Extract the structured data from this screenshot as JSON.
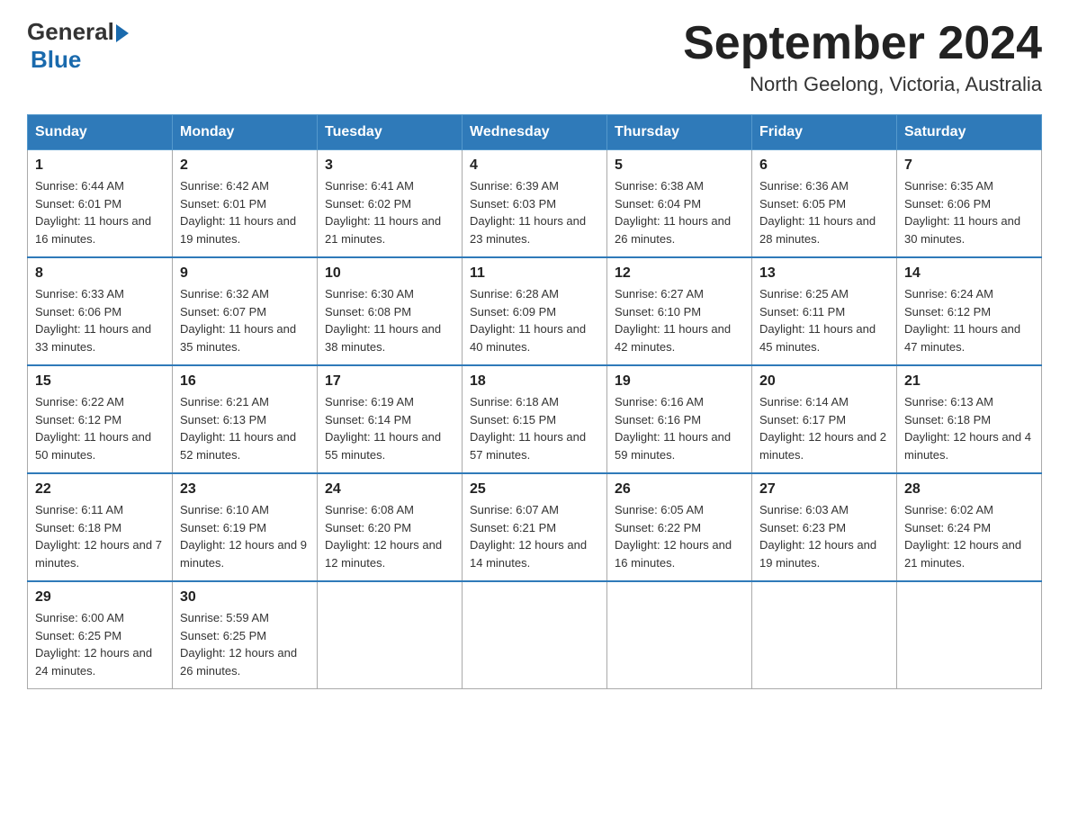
{
  "logo": {
    "text_general": "General",
    "text_blue": "Blue"
  },
  "title": "September 2024",
  "subtitle": "North Geelong, Victoria, Australia",
  "headers": [
    "Sunday",
    "Monday",
    "Tuesday",
    "Wednesday",
    "Thursday",
    "Friday",
    "Saturday"
  ],
  "weeks": [
    [
      {
        "day": "1",
        "sunrise": "6:44 AM",
        "sunset": "6:01 PM",
        "daylight": "11 hours and 16 minutes."
      },
      {
        "day": "2",
        "sunrise": "6:42 AM",
        "sunset": "6:01 PM",
        "daylight": "11 hours and 19 minutes."
      },
      {
        "day": "3",
        "sunrise": "6:41 AM",
        "sunset": "6:02 PM",
        "daylight": "11 hours and 21 minutes."
      },
      {
        "day": "4",
        "sunrise": "6:39 AM",
        "sunset": "6:03 PM",
        "daylight": "11 hours and 23 minutes."
      },
      {
        "day": "5",
        "sunrise": "6:38 AM",
        "sunset": "6:04 PM",
        "daylight": "11 hours and 26 minutes."
      },
      {
        "day": "6",
        "sunrise": "6:36 AM",
        "sunset": "6:05 PM",
        "daylight": "11 hours and 28 minutes."
      },
      {
        "day": "7",
        "sunrise": "6:35 AM",
        "sunset": "6:06 PM",
        "daylight": "11 hours and 30 minutes."
      }
    ],
    [
      {
        "day": "8",
        "sunrise": "6:33 AM",
        "sunset": "6:06 PM",
        "daylight": "11 hours and 33 minutes."
      },
      {
        "day": "9",
        "sunrise": "6:32 AM",
        "sunset": "6:07 PM",
        "daylight": "11 hours and 35 minutes."
      },
      {
        "day": "10",
        "sunrise": "6:30 AM",
        "sunset": "6:08 PM",
        "daylight": "11 hours and 38 minutes."
      },
      {
        "day": "11",
        "sunrise": "6:28 AM",
        "sunset": "6:09 PM",
        "daylight": "11 hours and 40 minutes."
      },
      {
        "day": "12",
        "sunrise": "6:27 AM",
        "sunset": "6:10 PM",
        "daylight": "11 hours and 42 minutes."
      },
      {
        "day": "13",
        "sunrise": "6:25 AM",
        "sunset": "6:11 PM",
        "daylight": "11 hours and 45 minutes."
      },
      {
        "day": "14",
        "sunrise": "6:24 AM",
        "sunset": "6:12 PM",
        "daylight": "11 hours and 47 minutes."
      }
    ],
    [
      {
        "day": "15",
        "sunrise": "6:22 AM",
        "sunset": "6:12 PM",
        "daylight": "11 hours and 50 minutes."
      },
      {
        "day": "16",
        "sunrise": "6:21 AM",
        "sunset": "6:13 PM",
        "daylight": "11 hours and 52 minutes."
      },
      {
        "day": "17",
        "sunrise": "6:19 AM",
        "sunset": "6:14 PM",
        "daylight": "11 hours and 55 minutes."
      },
      {
        "day": "18",
        "sunrise": "6:18 AM",
        "sunset": "6:15 PM",
        "daylight": "11 hours and 57 minutes."
      },
      {
        "day": "19",
        "sunrise": "6:16 AM",
        "sunset": "6:16 PM",
        "daylight": "11 hours and 59 minutes."
      },
      {
        "day": "20",
        "sunrise": "6:14 AM",
        "sunset": "6:17 PM",
        "daylight": "12 hours and 2 minutes."
      },
      {
        "day": "21",
        "sunrise": "6:13 AM",
        "sunset": "6:18 PM",
        "daylight": "12 hours and 4 minutes."
      }
    ],
    [
      {
        "day": "22",
        "sunrise": "6:11 AM",
        "sunset": "6:18 PM",
        "daylight": "12 hours and 7 minutes."
      },
      {
        "day": "23",
        "sunrise": "6:10 AM",
        "sunset": "6:19 PM",
        "daylight": "12 hours and 9 minutes."
      },
      {
        "day": "24",
        "sunrise": "6:08 AM",
        "sunset": "6:20 PM",
        "daylight": "12 hours and 12 minutes."
      },
      {
        "day": "25",
        "sunrise": "6:07 AM",
        "sunset": "6:21 PM",
        "daylight": "12 hours and 14 minutes."
      },
      {
        "day": "26",
        "sunrise": "6:05 AM",
        "sunset": "6:22 PM",
        "daylight": "12 hours and 16 minutes."
      },
      {
        "day": "27",
        "sunrise": "6:03 AM",
        "sunset": "6:23 PM",
        "daylight": "12 hours and 19 minutes."
      },
      {
        "day": "28",
        "sunrise": "6:02 AM",
        "sunset": "6:24 PM",
        "daylight": "12 hours and 21 minutes."
      }
    ],
    [
      {
        "day": "29",
        "sunrise": "6:00 AM",
        "sunset": "6:25 PM",
        "daylight": "12 hours and 24 minutes."
      },
      {
        "day": "30",
        "sunrise": "5:59 AM",
        "sunset": "6:25 PM",
        "daylight": "12 hours and 26 minutes."
      },
      null,
      null,
      null,
      null,
      null
    ]
  ],
  "labels": {
    "sunrise_prefix": "Sunrise: ",
    "sunset_prefix": "Sunset: ",
    "daylight_prefix": "Daylight: "
  }
}
